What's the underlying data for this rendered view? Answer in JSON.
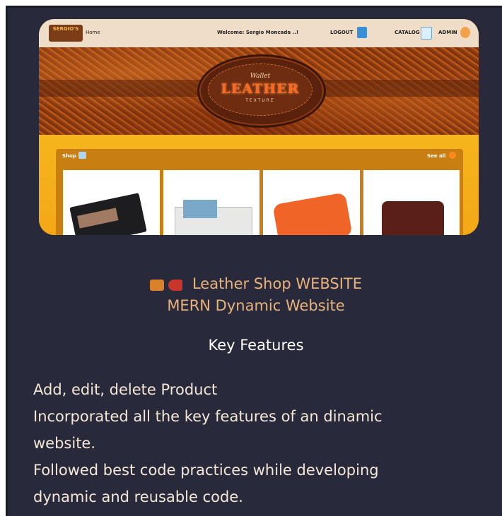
{
  "screenshot": {
    "nav": {
      "logo_text": "SERGIO'S",
      "home": "Home",
      "welcome": "Welcome: Sergio Moncada ..!",
      "logout": "LOGOUT",
      "catalog": "CATALOG",
      "admin": "ADMIN"
    },
    "hero": {
      "script_text": "Wallet",
      "main_text": "LEATHER",
      "sub_text": "TEXTURE"
    },
    "shop": {
      "label": "Shop",
      "see_all": "See all",
      "products": [
        "wallet-black",
        "wallet-white",
        "wallet-orange",
        "wallet-brown"
      ]
    }
  },
  "title": {
    "line1": "Leather Shop WEBSITE",
    "line2": "MERN Dynamic Website"
  },
  "features_heading": "Key Features",
  "body": {
    "line1": "Add, edit, delete Product",
    "line2": "Incorporated all the key features of an dinamic",
    "line3": "website.",
    "line4": "Followed best code practices while developing",
    "line5": "dynamic and reusable code."
  },
  "colors": {
    "background": "#282a3c",
    "title": "#e9b27a",
    "accent_yellow": "#f4b01a",
    "leather": "#a34712"
  },
  "icons": [
    "briefcase-icon",
    "shoe-icon"
  ]
}
